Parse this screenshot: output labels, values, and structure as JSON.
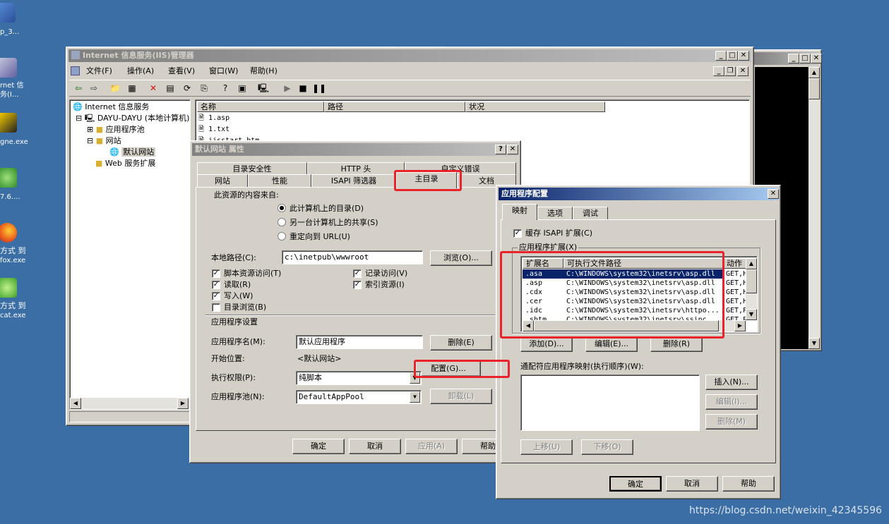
{
  "desktop": {
    "icons": [
      {
        "label1": "p_3...",
        "label2": ""
      },
      {
        "label1": "rnet 信",
        "label2": "务(I..."
      },
      {
        "label1": "gne.exe",
        "label2": ""
      },
      {
        "label1": "7.6....",
        "label2": ""
      },
      {
        "label1": "方式 到",
        "label2": "fox.exe"
      },
      {
        "label1": "方式 到",
        "label2": "cat.exe"
      }
    ]
  },
  "iis": {
    "title": "Internet 信息服务(IIS)管理器",
    "menu": [
      "文件(F)",
      "操作(A)",
      "查看(V)",
      "窗口(W)",
      "帮助(H)"
    ],
    "tree": {
      "root": "Internet 信息服务",
      "computer": "DAYU-DAYU (本地计算机)",
      "apppools": "应用程序池",
      "websites": "网站",
      "default_site": "默认网站",
      "webext": "Web 服务扩展"
    },
    "list_headers": [
      "名称",
      "路径",
      "状况"
    ],
    "files": [
      "1.asp",
      "1.txt",
      "iisstart.htm"
    ]
  },
  "props": {
    "title": "默认网站 属性",
    "tabs_back": [
      "目录安全性",
      "HTTP 头",
      "自定义错误"
    ],
    "tabs_front": [
      "网站",
      "性能",
      "ISAPI 筛选器",
      "主目录",
      "文档"
    ],
    "source_label": "此资源的内容来自:",
    "radios": [
      "此计算机上的目录(D)",
      "另一台计算机上的共享(S)",
      "重定向到 URL(U)"
    ],
    "local_path_label": "本地路径(C):",
    "local_path_value": "c:\\inetpub\\wwwroot",
    "browse": "浏览(O)...",
    "checks_left": [
      "脚本资源访问(T)",
      "读取(R)",
      "写入(W)",
      "目录浏览(B)"
    ],
    "checks_right": [
      "记录访问(V)",
      "索引资源(I)"
    ],
    "app_settings": "应用程序设置",
    "app_name_label": "应用程序名(M):",
    "app_name_value": "默认应用程序",
    "remove": "删除(E)",
    "start_label": "开始位置:",
    "start_value": "<默认网站>",
    "config": "配置(G)...",
    "exec_label": "执行权限(P):",
    "exec_value": "纯脚本",
    "pool_label": "应用程序池(N):",
    "pool_value": "DefaultAppPool",
    "unload": "卸载(L)",
    "ok": "确定",
    "cancel": "取消",
    "apply": "应用(A)",
    "help": "帮助"
  },
  "appconfig": {
    "title": "应用程序配置",
    "tabs": [
      "映射",
      "选项",
      "调试"
    ],
    "cache": "缓存 ISAPI 扩展(C)",
    "ext_group": "应用程序扩展(X)",
    "headers": [
      "扩展名",
      "可执行文件路径",
      "动作"
    ],
    "rows": [
      {
        "ext": ".asa",
        "path": "C:\\WINDOWS\\system32\\inetsrv\\asp.dll",
        "verb": "GET,H"
      },
      {
        "ext": ".asp",
        "path": "C:\\WINDOWS\\system32\\inetsrv\\asp.dll",
        "verb": "GET,H"
      },
      {
        "ext": ".cdx",
        "path": "C:\\WINDOWS\\system32\\inetsrv\\asp.dll",
        "verb": "GET,H"
      },
      {
        "ext": ".cer",
        "path": "C:\\WINDOWS\\system32\\inetsrv\\asp.dll",
        "verb": "GET,H"
      },
      {
        "ext": ".idc",
        "path": "C:\\WINDOWS\\system32\\inetsrv\\httpo...",
        "verb": "GET,P"
      },
      {
        "ext": ".shtm",
        "path": "C:\\WINDOWS\\system32\\inetsrv\\ssinc...",
        "verb": "GET,P"
      }
    ],
    "add": "添加(D)...",
    "edit": "编辑(E)...",
    "remove": "删除(R)",
    "wildcard_label": "通配符应用程序映射(执行顺序)(W):",
    "insert": "插入(N)...",
    "edit2": "编辑(I)...",
    "remove2": "删除(M)",
    "up": "上移(U)",
    "down": "下移(O)",
    "ok": "确定",
    "cancel": "取消",
    "help": "帮助"
  },
  "watermark": "https://blog.csdn.net/weixin_42345596"
}
